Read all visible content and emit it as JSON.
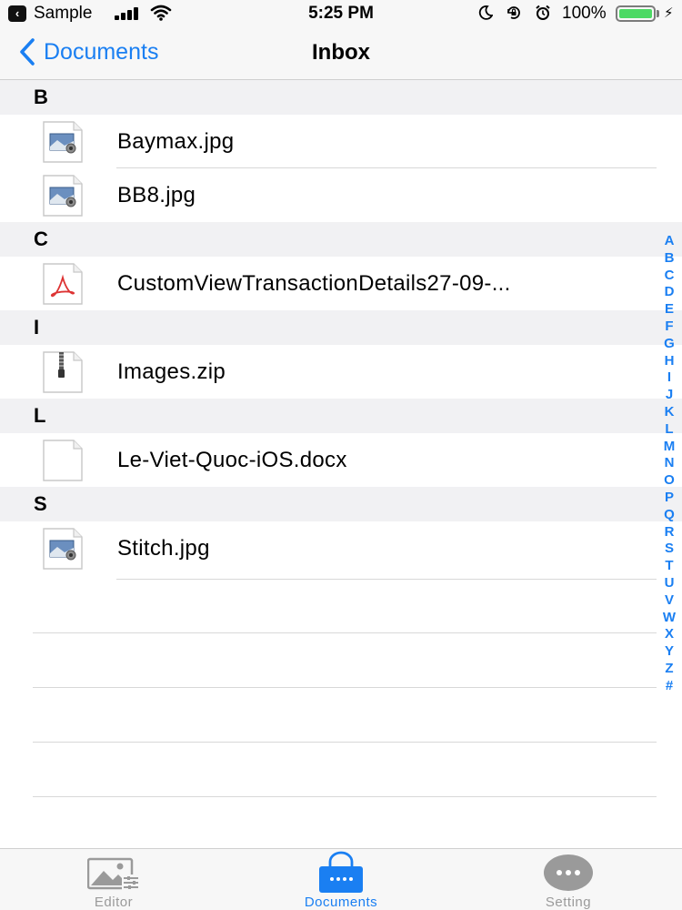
{
  "status_bar": {
    "back_app": "Sample",
    "time": "5:25 PM",
    "battery_percent": "100%",
    "icons": [
      "moon-icon",
      "rotation-lock-icon",
      "alarm-icon"
    ],
    "battery_level": 1.0
  },
  "nav": {
    "back_label": "Documents",
    "title": "Inbox"
  },
  "sections": [
    {
      "letter": "B",
      "files": [
        {
          "name": "Baymax.jpg",
          "type": "image"
        },
        {
          "name": "BB8.jpg",
          "type": "image"
        }
      ]
    },
    {
      "letter": "C",
      "files": [
        {
          "name": "CustomViewTransactionDetails27-09-...",
          "type": "pdf"
        }
      ]
    },
    {
      "letter": "I",
      "files": [
        {
          "name": "Images.zip",
          "type": "zip"
        }
      ]
    },
    {
      "letter": "L",
      "files": [
        {
          "name": "Le-Viet-Quoc-iOS.docx",
          "type": "doc"
        }
      ]
    },
    {
      "letter": "S",
      "files": [
        {
          "name": "Stitch.jpg",
          "type": "image"
        }
      ]
    }
  ],
  "index_letters": [
    "A",
    "B",
    "C",
    "D",
    "E",
    "F",
    "G",
    "H",
    "I",
    "J",
    "K",
    "L",
    "M",
    "N",
    "O",
    "P",
    "Q",
    "R",
    "S",
    "T",
    "U",
    "V",
    "W",
    "X",
    "Y",
    "Z",
    "#"
  ],
  "tabs": [
    {
      "label": "Editor",
      "icon": "editor-icon",
      "active": false
    },
    {
      "label": "Documents",
      "icon": "documents-icon",
      "active": true
    },
    {
      "label": "Setting",
      "icon": "setting-icon",
      "active": false
    }
  ],
  "colors": {
    "accent": "#1a7ff2",
    "battery": "#4cd964",
    "section_bg": "#f1f1f3",
    "inactive_tab": "#9a9a9a"
  }
}
